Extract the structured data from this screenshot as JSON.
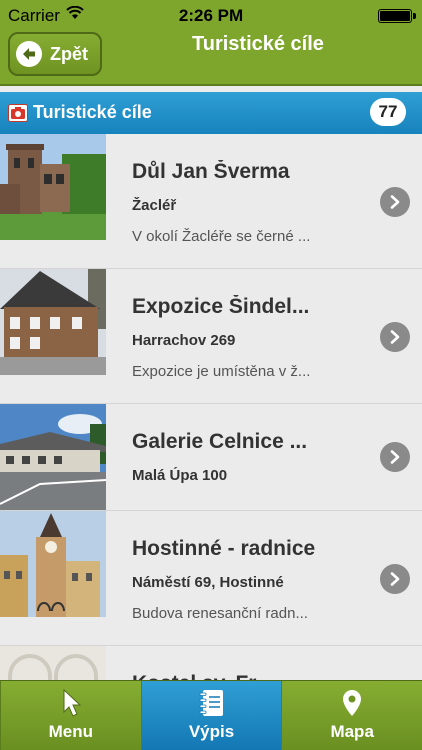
{
  "status": {
    "carrier": "Carrier",
    "time": "2:26 PM"
  },
  "nav": {
    "back_label": "Zpět",
    "title": "Turistické cíle"
  },
  "section": {
    "title": "Turistické cíle",
    "count": "77"
  },
  "items": [
    {
      "name": "Důl Jan Šverma",
      "place": "Žacléř",
      "desc": "V okolí Žacléře se černé ...",
      "thumb_icon": "mine-building-photo"
    },
    {
      "name": "Expozice Šindel...",
      "place": "Harrachov 269",
      "desc": "Expozice je umístěna v ž...",
      "thumb_icon": "wooden-house-photo"
    },
    {
      "name": "Galerie Celnice ...",
      "place": "Malá Úpa 100",
      "desc": "",
      "thumb_icon": "gallery-building-photo"
    },
    {
      "name": "Hostinné - radnice",
      "place": "Náměstí 69, Hostinné",
      "desc": "Budova renesanční radn...",
      "thumb_icon": "town-hall-photo"
    },
    {
      "name": "Kostel sv. Fr...",
      "place": "",
      "desc": "",
      "thumb_icon": "church-interior-photo"
    }
  ],
  "tabs": [
    {
      "label": "Menu",
      "icon": "cursor-arrow-icon"
    },
    {
      "label": "Výpis",
      "icon": "notebook-icon"
    },
    {
      "label": "Mapa",
      "icon": "map-pin-icon"
    }
  ],
  "colors": {
    "green": "#7ea52c",
    "blue": "#1f8fca",
    "row_bg": "#ebebeb"
  }
}
